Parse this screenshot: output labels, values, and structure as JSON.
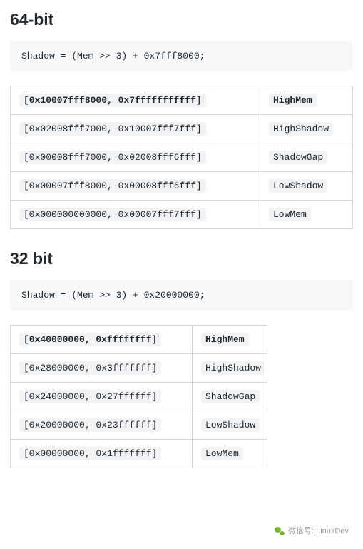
{
  "section64": {
    "heading": "64-bit",
    "code": "Shadow = (Mem >> 3) + 0x7fff8000;",
    "rows": [
      {
        "range": "[0x10007fff8000, 0x7fffffffffff]",
        "name": "HighMem",
        "bold": true
      },
      {
        "range": "[0x02008fff7000, 0x10007fff7fff]",
        "name": "HighShadow",
        "bold": false
      },
      {
        "range": "[0x00008fff7000, 0x02008fff6fff]",
        "name": "ShadowGap",
        "bold": false
      },
      {
        "range": "[0x00007fff8000, 0x00008fff6fff]",
        "name": "LowShadow",
        "bold": false
      },
      {
        "range": "[0x000000000000, 0x00007fff7fff]",
        "name": "LowMem",
        "bold": false
      }
    ]
  },
  "section32": {
    "heading": "32 bit",
    "code": "Shadow = (Mem >> 3) + 0x20000000;",
    "rows": [
      {
        "range": "[0x40000000, 0xffffffff]",
        "name": "HighMem",
        "bold": true
      },
      {
        "range": "[0x28000000, 0x3fffffff]",
        "name": "HighShadow",
        "bold": false
      },
      {
        "range": "[0x24000000, 0x27ffffff]",
        "name": "ShadowGap",
        "bold": false
      },
      {
        "range": "[0x20000000, 0x23ffffff]",
        "name": "LowShadow",
        "bold": false
      },
      {
        "range": "[0x00000000, 0x1fffffff]",
        "name": "LowMem",
        "bold": false
      }
    ]
  },
  "footer": {
    "label": "微信号: LinuxDev"
  }
}
